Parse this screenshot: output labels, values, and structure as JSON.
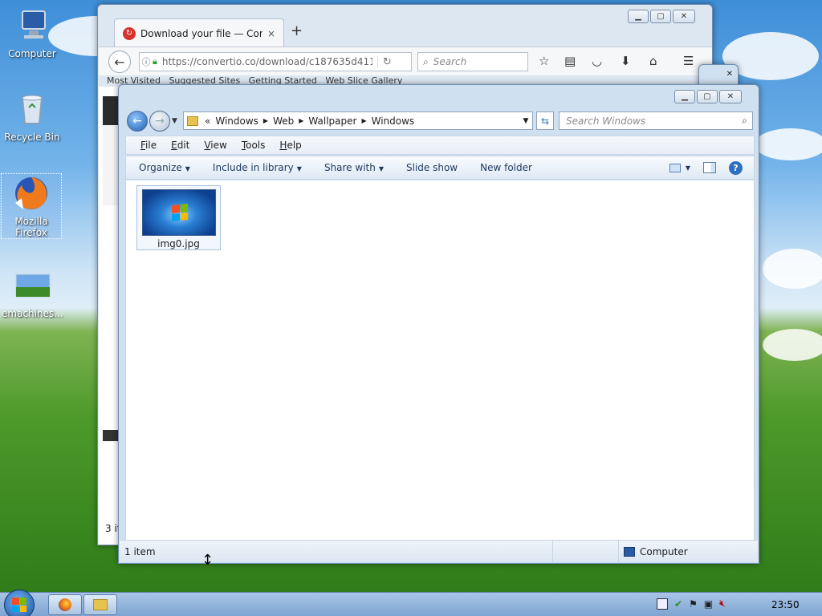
{
  "desktop": {
    "icons": [
      {
        "label": "Computer"
      },
      {
        "label": "Recycle Bin"
      },
      {
        "label": "Mozilla Firefox"
      },
      {
        "label": "emachines..."
      }
    ]
  },
  "firefox": {
    "tab_title": "Download your file — Con...",
    "tab_close": "×",
    "new_tab": "+",
    "url": "https://convertio.co/download/c187635d411(",
    "search_placeholder": "Search",
    "bookmarks": [
      "Most Visited",
      "Suggested Sites",
      "Getting Started",
      "Web Slice Gallery"
    ],
    "status_text": "3 it"
  },
  "explorer": {
    "breadcrumb": [
      "Windows",
      "Web",
      "Wallpaper",
      "Windows"
    ],
    "breadcrumb_prefix": "«",
    "search_placeholder": "Search Windows",
    "menu": [
      "File",
      "Edit",
      "View",
      "Tools",
      "Help"
    ],
    "commands": {
      "organize": "Organize",
      "include_in_library": "Include in library",
      "share_with": "Share with",
      "slide_show": "Slide show",
      "new_folder": "New folder"
    },
    "files": [
      {
        "name": "img0.jpg"
      }
    ],
    "status_count": "1 item",
    "status_location": "Computer"
  },
  "taskbar": {
    "clock": "23:50"
  },
  "colors": {
    "accent": "#2f6fc0",
    "taskbar": "#7ea4d2",
    "window_frame": "#cfe0f1"
  }
}
